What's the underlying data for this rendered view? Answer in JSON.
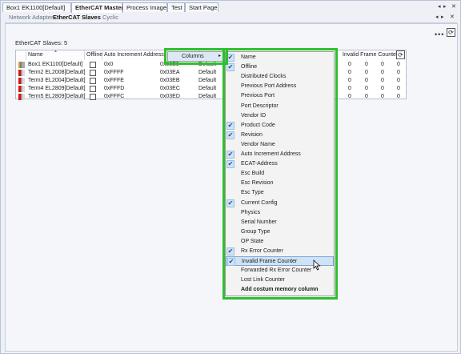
{
  "doc_tabs": [
    {
      "label": "Box1 EK1100[Default]",
      "active": false
    },
    {
      "label": "EtherCAT Master",
      "active": true
    },
    {
      "label": "Process Image",
      "active": false
    },
    {
      "label": "Test",
      "active": false
    },
    {
      "label": "Start Page",
      "active": false
    }
  ],
  "inner_tabs": [
    {
      "label": "Network Adapter",
      "active": false
    },
    {
      "label": "EtherCAT Slaves",
      "active": true
    },
    {
      "label": "Cyclic",
      "active": false
    }
  ],
  "toolbar": {
    "more_glyph": "•••",
    "refresh_glyph": "⟳"
  },
  "slaves_label": "EtherCAT Slaves: 5",
  "table": {
    "sort_glyph": "▲",
    "headers": {
      "name": "Name",
      "offline": "Offline",
      "auto_inc": "Auto Increment Address",
      "ecat": "E",
      "invalid_frame": "Invalid Frame Counter"
    },
    "rows": [
      {
        "icon": "ek1100-coupler-icon",
        "name": "Box1 EK1100[Default]",
        "auto_inc": "0x0",
        "ecat": "0x03E9",
        "rev": "Default",
        "c1": "0",
        "c2": "0",
        "c3": "0",
        "c4": "0"
      },
      {
        "icon": "terminal-red-icon",
        "name": "Term2 EL2008[Default]",
        "auto_inc": "0xFFFF",
        "ecat": "0x03EA",
        "rev": "Default",
        "c1": "0",
        "c2": "0",
        "c3": "0",
        "c4": "0"
      },
      {
        "icon": "terminal-red-icon",
        "name": "Term3 EL2004[Default]",
        "auto_inc": "0xFFFE",
        "ecat": "0x03EB",
        "rev": "Default",
        "c1": "0",
        "c2": "0",
        "c3": "0",
        "c4": "0"
      },
      {
        "icon": "terminal-red-icon",
        "name": "Term4 EL2809[Default]",
        "auto_inc": "0xFFFD",
        "ecat": "0x03EC",
        "rev": "Default",
        "c1": "0",
        "c2": "0",
        "c3": "0",
        "c4": "0"
      },
      {
        "icon": "terminal-red-icon",
        "name": "Term5 EL2809[Default]",
        "auto_inc": "0xFFFC",
        "ecat": "0x03ED",
        "rev": "Default",
        "c1": "0",
        "c2": "0",
        "c3": "0",
        "c4": "0"
      }
    ]
  },
  "context_menu": {
    "columns_label": "Columns",
    "arrow": "▸"
  },
  "columns_menu": {
    "check_glyph": "✔",
    "items": [
      {
        "label": "Name",
        "checked": true
      },
      {
        "label": "Offline",
        "checked": true
      },
      {
        "label": "Distributed Clocks",
        "checked": false
      },
      {
        "label": "Previous Port Address",
        "checked": false
      },
      {
        "label": "Previous Port",
        "checked": false
      },
      {
        "label": "Port Descriptor",
        "checked": false
      },
      {
        "label": "Vendor ID",
        "checked": false
      },
      {
        "label": "Product Code",
        "checked": true
      },
      {
        "label": "Revision",
        "checked": true
      },
      {
        "label": "Vendor Name",
        "checked": false
      },
      {
        "label": "Auto Increment Address",
        "checked": true
      },
      {
        "label": "ECAT-Address",
        "checked": true
      },
      {
        "label": "Esc Build",
        "checked": false
      },
      {
        "label": "Esc Revision",
        "checked": false
      },
      {
        "label": "Esc Type",
        "checked": false
      },
      {
        "label": "Current Config",
        "checked": true
      },
      {
        "label": "Physics",
        "checked": false
      },
      {
        "label": "Serial Number",
        "checked": false
      },
      {
        "label": "Group Type",
        "checked": false
      },
      {
        "label": "OP State",
        "checked": false
      },
      {
        "label": "Rx Error Counter",
        "checked": true
      },
      {
        "label": "Invalid Frame Counter",
        "checked": true,
        "hover": true
      },
      {
        "label": "Forwarded Rx Error Counter",
        "checked": false
      },
      {
        "label": "Lost Link Counter",
        "checked": false
      },
      {
        "label": "Add costum memory column",
        "checked": false,
        "bold": true
      }
    ]
  },
  "colors": {
    "highlight_green": "#2dc02d",
    "menu_hover": "#cfe2f6",
    "check_blue": "#1d4f8c"
  }
}
